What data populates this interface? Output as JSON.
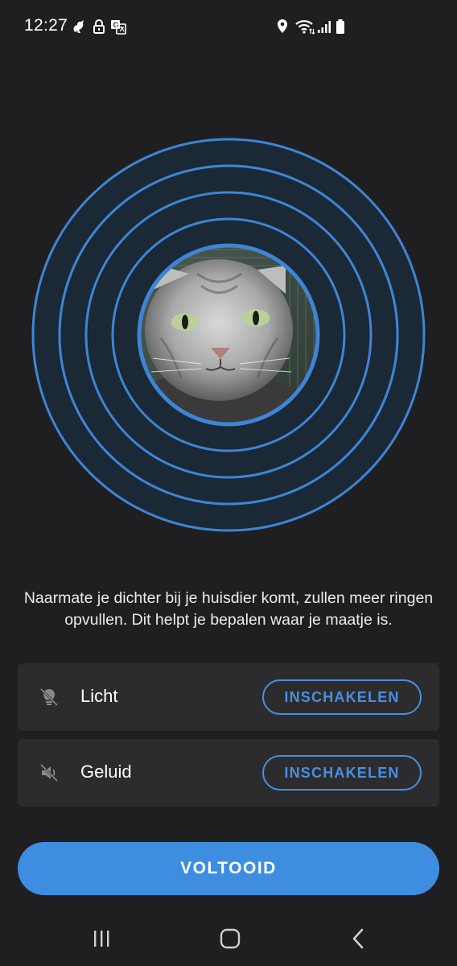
{
  "status_bar": {
    "time": "12:27",
    "left_icons": [
      "notification-bird-icon",
      "lock-icon",
      "translate-icon"
    ],
    "right_icons": [
      "location-icon",
      "wifi-icon",
      "signal-icon",
      "battery-icon"
    ]
  },
  "tracker": {
    "ring_count": 5,
    "ring_color": "#3d85d6",
    "ring_fill": "#1b2835",
    "pet_photo": "cat-photo"
  },
  "description": "Naarmate je dichter bij je huisdier komt, zullen meer ringen opvullen. Dit helpt je bepalen waar je maatje is.",
  "options": [
    {
      "icon": "light-off-icon",
      "label": "Licht",
      "button": "INSCHAKELEN"
    },
    {
      "icon": "sound-off-icon",
      "label": "Geluid",
      "button": "INSCHAKELEN"
    }
  ],
  "done_button": "VOLTOOID",
  "nav": {
    "recents": "recents-icon",
    "home": "home-icon",
    "back": "back-icon"
  },
  "colors": {
    "background": "#1f1f21",
    "card": "#2c2c2f",
    "accent": "#3d8ee0"
  }
}
